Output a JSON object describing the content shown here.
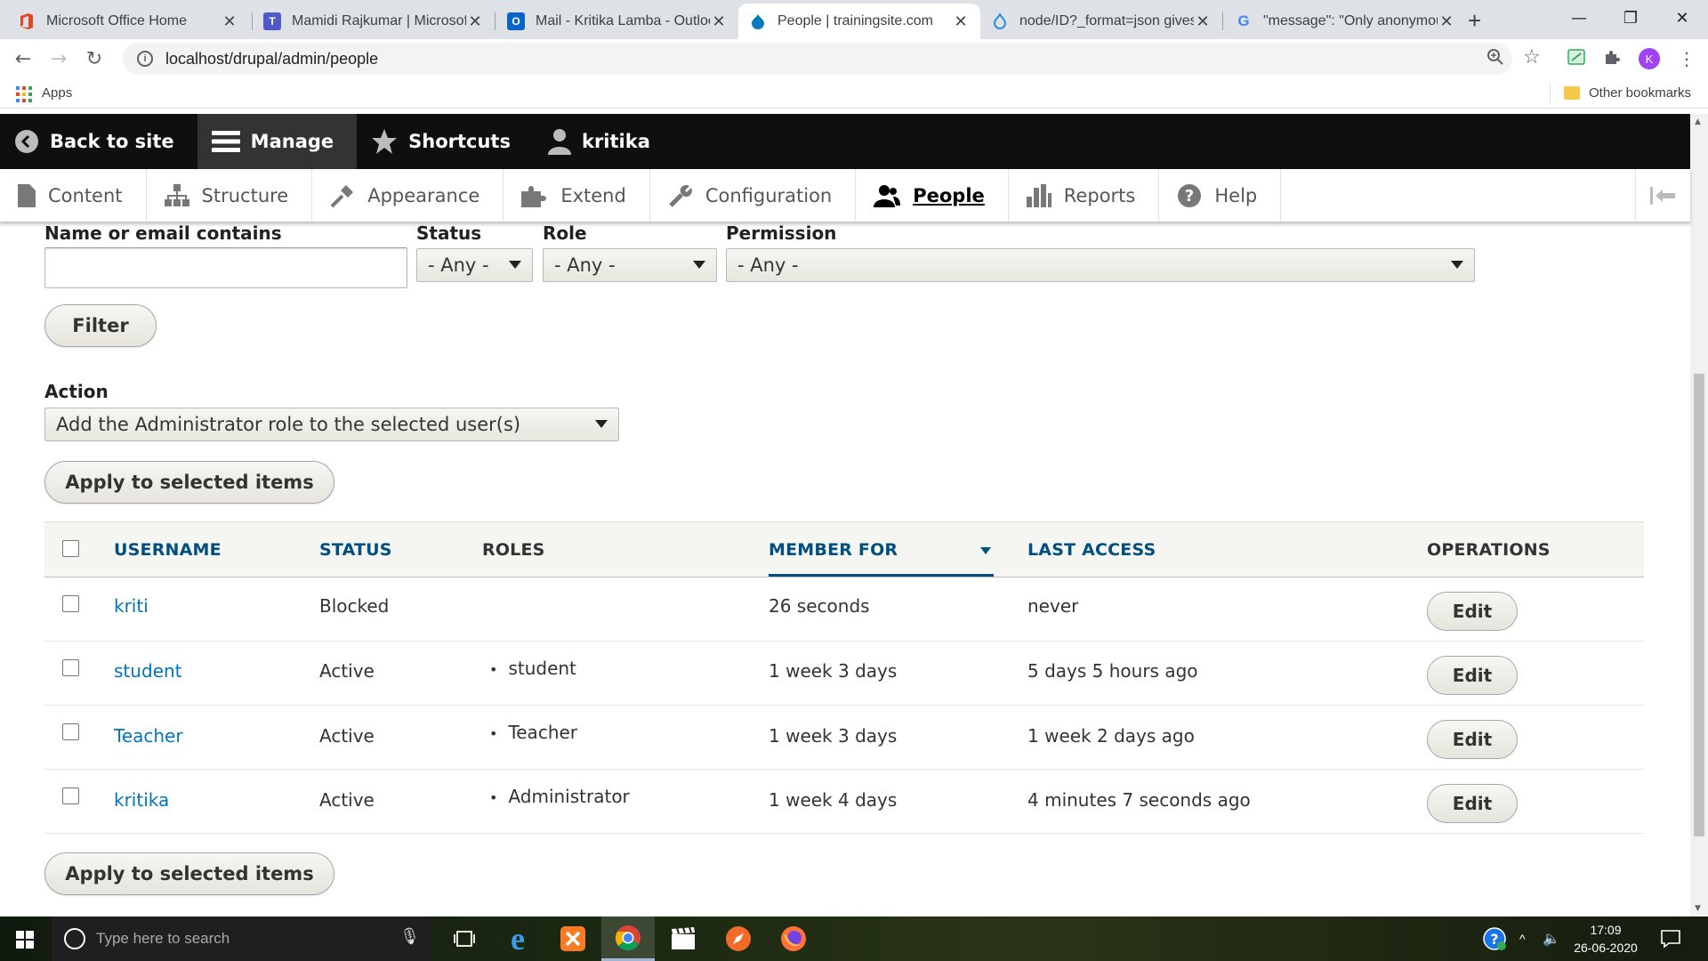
{
  "browser": {
    "tabs": [
      {
        "title": "Microsoft Office Home",
        "favicon": "office-icon",
        "active": false
      },
      {
        "title": "Mamidi Rajkumar | Microsoft",
        "favicon": "teams-icon",
        "active": false
      },
      {
        "title": "Mail - Kritika Lamba - Outloo",
        "favicon": "outlook-icon",
        "active": false
      },
      {
        "title": "People | trainingsite.com",
        "favicon": "drupal-icon",
        "active": true
      },
      {
        "title": "node/ID?_format=json gives",
        "favicon": "drupal-drop-icon",
        "active": false
      },
      {
        "title": "\"message\": \"Only anonymou",
        "favicon": "google-icon",
        "active": false
      }
    ],
    "url": "localhost/drupal/admin/people",
    "profile_initial": "K",
    "bookmarks": {
      "apps_label": "Apps",
      "other_label": "Other bookmarks"
    }
  },
  "admin_toolbar": {
    "back_to_site": "Back to site",
    "manage": "Manage",
    "shortcuts": "Shortcuts",
    "user": "kritika"
  },
  "admin_tray": {
    "items": [
      {
        "label": "Content",
        "icon": "content-icon"
      },
      {
        "label": "Structure",
        "icon": "structure-icon"
      },
      {
        "label": "Appearance",
        "icon": "appearance-icon"
      },
      {
        "label": "Extend",
        "icon": "extend-icon"
      },
      {
        "label": "Configuration",
        "icon": "configuration-icon"
      },
      {
        "label": "People",
        "icon": "people-icon",
        "active": true
      },
      {
        "label": "Reports",
        "icon": "reports-icon"
      },
      {
        "label": "Help",
        "icon": "help-icon"
      }
    ]
  },
  "filters": {
    "name_label": "Name or email contains",
    "name_value": "",
    "status_label": "Status",
    "status_value": "- Any -",
    "role_label": "Role",
    "role_value": "- Any -",
    "permission_label": "Permission",
    "permission_value": "- Any -",
    "filter_button": "Filter"
  },
  "bulk": {
    "action_label": "Action",
    "action_value": "Add the Administrator role to the selected user(s)",
    "apply_button": "Apply to selected items"
  },
  "table": {
    "headers": {
      "username": "USERNAME",
      "status": "STATUS",
      "roles": "ROLES",
      "member_for": "MEMBER FOR",
      "last_access": "LAST ACCESS",
      "operations": "OPERATIONS"
    },
    "rows": [
      {
        "username": "kriti",
        "status": "Blocked",
        "role": "",
        "member_for": "26 seconds",
        "last_access": "never",
        "op": "Edit"
      },
      {
        "username": "student",
        "status": "Active",
        "role": "student",
        "member_for": "1 week 3 days",
        "last_access": "5 days 5 hours ago",
        "op": "Edit"
      },
      {
        "username": "Teacher",
        "status": "Active",
        "role": "Teacher",
        "member_for": "1 week 3 days",
        "last_access": "1 week 2 days ago",
        "op": "Edit"
      },
      {
        "username": "kritika",
        "status": "Active",
        "role": "Administrator",
        "member_for": "1 week 4 days",
        "last_access": "4 minutes 7 seconds ago",
        "op": "Edit"
      }
    ]
  },
  "taskbar": {
    "search_placeholder": "Type here to search",
    "time": "17:09",
    "date": "26-06-2020"
  },
  "colors": {
    "link": "#0074bd",
    "header_link": "#004f80",
    "toolbar_bg": "#0f0f0f"
  }
}
